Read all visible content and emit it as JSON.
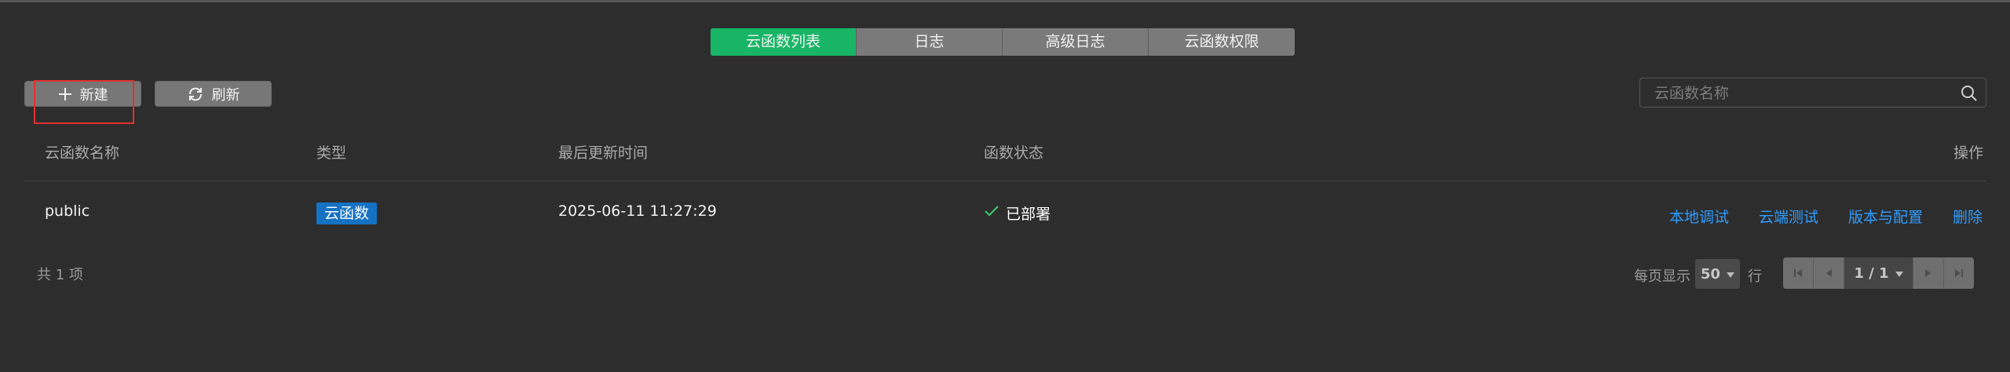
{
  "tabs": [
    {
      "label": "云函数列表",
      "active": true
    },
    {
      "label": "日志",
      "active": false
    },
    {
      "label": "高级日志",
      "active": false
    },
    {
      "label": "云函数权限",
      "active": false
    }
  ],
  "toolbar": {
    "new_label": "新建",
    "refresh_label": "刷新",
    "new_icon": "plus-icon",
    "refresh_icon": "refresh-icon"
  },
  "search": {
    "placeholder": "云函数名称",
    "value": "",
    "icon": "search-icon"
  },
  "table": {
    "headers": [
      "云函数名称",
      "类型",
      "最后更新时间",
      "函数状态",
      "操作"
    ],
    "rows": [
      {
        "name": "public",
        "type": "云函数",
        "updated": "2025-06-11 11:27:29",
        "status": "已部署",
        "status_icon": "check-icon",
        "actions": [
          "本地调试",
          "云端测试",
          "版本与配置",
          "删除"
        ]
      }
    ]
  },
  "footer": {
    "total_text": "共 1 项",
    "page_size_label": "每页显示",
    "page_size": "50",
    "row_label": "行",
    "page_indicator": "1 / 1"
  },
  "colors": {
    "background": "#2d2d2d",
    "active_tab": "#18b566",
    "link": "#2e9cff",
    "badge": "#1572c2",
    "status_ok": "#3cc46b",
    "highlight": "#e03030"
  }
}
